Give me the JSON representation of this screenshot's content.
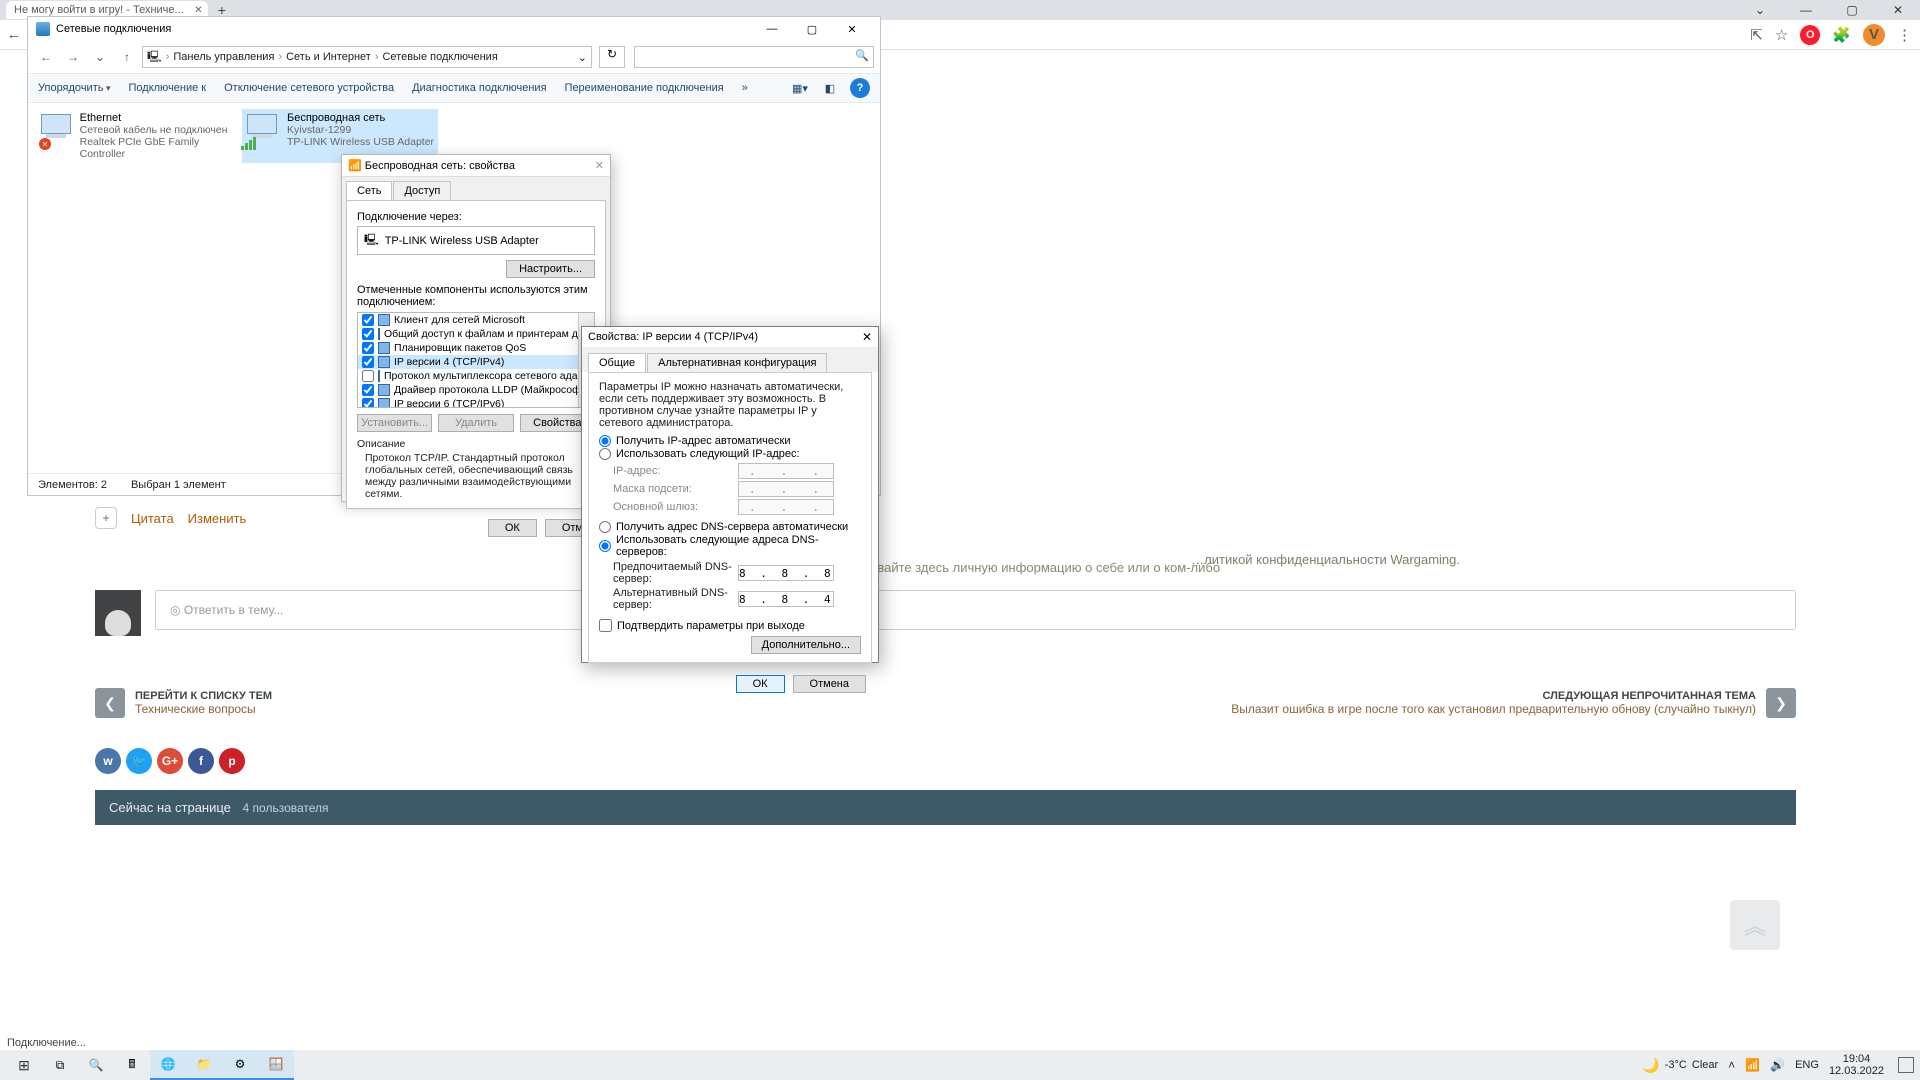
{
  "browser": {
    "tab_title": "Не могу войти в игру! - Техниче...",
    "avatar_letter": "V"
  },
  "chrome_controls": {
    "min": "—",
    "max": "▢",
    "close": "✕"
  },
  "explorer": {
    "title": "Сетевые подключения",
    "path": {
      "root": "Панель управления",
      "mid": "Сеть и Интернет",
      "leaf": "Сетевые подключения"
    },
    "toolbar": {
      "organize": "Упорядочить",
      "connect": "Подключение к",
      "disable": "Отключение сетевого устройства",
      "diag": "Диагностика подключения",
      "rename": "Переименование подключения",
      "more": "»"
    },
    "items": [
      {
        "name": "Ethernet",
        "sub": "Сетевой кабель не подключен",
        "adapter": "Realtek PCIe GbE Family Controller",
        "state": "off"
      },
      {
        "name": "Беспроводная сеть",
        "sub": "Kyivstar-1299",
        "adapter": "TP-LINK Wireless USB Adapter",
        "state": "on"
      }
    ],
    "status_left": "Элементов: 2",
    "status_right": "Выбран 1 элемент"
  },
  "props_a": {
    "title": "Беспроводная сеть: свойства",
    "tabs": {
      "net": "Сеть",
      "access": "Доступ"
    },
    "via_label": "Подключение через:",
    "adapter": "TP-LINK Wireless USB Adapter",
    "configure": "Настроить...",
    "used_label": "Отмеченные компоненты используются этим подключением:",
    "components": [
      {
        "label": "Клиент для сетей Microsoft",
        "checked": true
      },
      {
        "label": "Общий доступ к файлам и принтерам для сетей Mi",
        "checked": true
      },
      {
        "label": "Планировщик пакетов QoS",
        "checked": true
      },
      {
        "label": "IP версии 4 (TCP/IPv4)",
        "checked": true,
        "selected": true
      },
      {
        "label": "Протокол мультиплексора сетевого адаптера (Ma",
        "checked": false
      },
      {
        "label": "Драйвер протокола LLDP (Майкрософт)",
        "checked": true
      },
      {
        "label": "IP версии 6 (TCP/IPv6)",
        "checked": true
      }
    ],
    "install": "Установить...",
    "remove": "Удалить",
    "props": "Свойства",
    "desc_title": "Описание",
    "desc_text": "Протокол TCP/IP. Стандартный протокол глобальных сетей, обеспечивающий связь между различными взаимодействующими сетями.",
    "ok": "ОК",
    "cancel": "Отм"
  },
  "props_b": {
    "title": "Свойства: IP версии 4 (TCP/IPv4)",
    "tabs": {
      "general": "Общие",
      "alt": "Альтернативная конфигурация"
    },
    "hint": "Параметры IP можно назначать автоматически, если сеть поддерживает эту возможность. В противном случае узнайте параметры IP у сетевого администратора.",
    "radio": {
      "auto_ip": "Получить IP-адрес автоматически",
      "manual_ip": "Использовать следующий IP-адрес:",
      "auto_dns": "Получить адрес DNS-сервера автоматически",
      "manual_dns": "Использовать следующие адреса DNS-серверов:"
    },
    "fields": {
      "ip": "IP-адрес:",
      "mask": "Маска подсети:",
      "gateway": "Основной шлюз:",
      "dns1": "Предпочитаемый DNS-сервер:",
      "dns2": "Альтернативный DNS-сервер:"
    },
    "values": {
      "ip": ".  .  .",
      "mask": ".  .  .",
      "gateway": ".  .  .",
      "dns1": "8 . 8 . 8 . 8",
      "dns2": "8 . 8 . 4 . 4"
    },
    "chk_confirm": "Подтвердить параметры при выходе",
    "advanced": "Дополнительно...",
    "ok": "ОК",
    "cancel": "Отмена"
  },
  "forum": {
    "quote": "Цитата",
    "edit": "Изменить",
    "warn": "В целях безопасности не указывайте здесь личную информацию о себе или о ком-либо",
    "wg_right": "…литикой конфиденциальности Wargaming.",
    "reply_placeholder": "Ответить в тему...",
    "prev_title": "ПЕРЕЙТИ К СПИСКУ ТЕМ",
    "prev_sub": "Технические вопросы",
    "next_title": "СЛЕДУЮЩАЯ НЕПРОЧИТАННАЯ ТЕМА",
    "next_sub": "Вылазит ошибка в игре после того как установил предварительную обнову (случайно тыкнул)",
    "now_on_page": "Сейчас на странице",
    "users": "4 пользователя"
  },
  "taskbar": {
    "weather_temp": "-3°C",
    "weather_label": "Clear",
    "lang": "ENG",
    "time": "19:04",
    "date": "12.03.2022"
  },
  "connecting": "Подключение..."
}
